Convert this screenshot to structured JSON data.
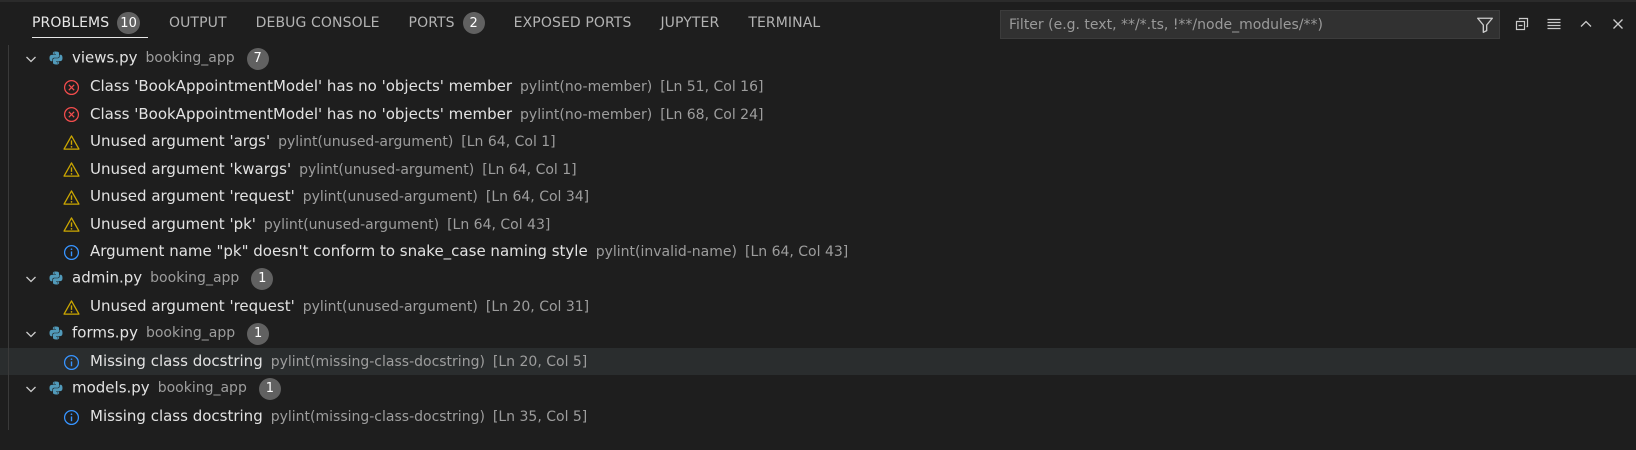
{
  "tabs": [
    {
      "label": "PROBLEMS",
      "badge": "10"
    },
    {
      "label": "OUTPUT"
    },
    {
      "label": "DEBUG CONSOLE"
    },
    {
      "label": "PORTS",
      "badge": "2"
    },
    {
      "label": "EXPOSED PORTS"
    },
    {
      "label": "JUPYTER"
    },
    {
      "label": "TERMINAL"
    }
  ],
  "filter": {
    "placeholder": "Filter (e.g. text, **/*.ts, !**/node_modules/**)"
  },
  "icons": {
    "filter": "filter-icon",
    "collapse_all": "collapse-all-icon",
    "view_as_list": "list-view-icon",
    "maximize": "chevron-up-icon",
    "close": "close-icon"
  },
  "colors": {
    "error": "#f14c4c",
    "warning": "#cca700",
    "info": "#3794ff",
    "python": "#519aba"
  },
  "files": [
    {
      "name": "views.py",
      "folder": "booking_app",
      "count": "7",
      "problems": [
        {
          "severity": "error",
          "message": "Class 'BookAppointmentModel' has no 'objects' member",
          "source": "pylint(no-member)",
          "location": "[Ln 51, Col 16]"
        },
        {
          "severity": "error",
          "message": "Class 'BookAppointmentModel' has no 'objects' member",
          "source": "pylint(no-member)",
          "location": "[Ln 68, Col 24]"
        },
        {
          "severity": "warning",
          "message": "Unused argument 'args'",
          "source": "pylint(unused-argument)",
          "location": "[Ln 64, Col 1]"
        },
        {
          "severity": "warning",
          "message": "Unused argument 'kwargs'",
          "source": "pylint(unused-argument)",
          "location": "[Ln 64, Col 1]"
        },
        {
          "severity": "warning",
          "message": "Unused argument 'request'",
          "source": "pylint(unused-argument)",
          "location": "[Ln 64, Col 34]"
        },
        {
          "severity": "warning",
          "message": "Unused argument 'pk'",
          "source": "pylint(unused-argument)",
          "location": "[Ln 64, Col 43]"
        },
        {
          "severity": "info",
          "message": "Argument name \"pk\" doesn't conform to snake_case naming style",
          "source": "pylint(invalid-name)",
          "location": "[Ln 64, Col 43]"
        }
      ]
    },
    {
      "name": "admin.py",
      "folder": "booking_app",
      "count": "1",
      "problems": [
        {
          "severity": "warning",
          "message": "Unused argument 'request'",
          "source": "pylint(unused-argument)",
          "location": "[Ln 20, Col 31]"
        }
      ]
    },
    {
      "name": "forms.py",
      "folder": "booking_app",
      "count": "1",
      "problems": [
        {
          "severity": "info",
          "message": "Missing class docstring",
          "source": "pylint(missing-class-docstring)",
          "location": "[Ln 20, Col 5]",
          "selected": true
        }
      ]
    },
    {
      "name": "models.py",
      "folder": "booking_app",
      "count": "1",
      "problems": [
        {
          "severity": "info",
          "message": "Missing class docstring",
          "source": "pylint(missing-class-docstring)",
          "location": "[Ln 35, Col 5]"
        }
      ]
    }
  ]
}
